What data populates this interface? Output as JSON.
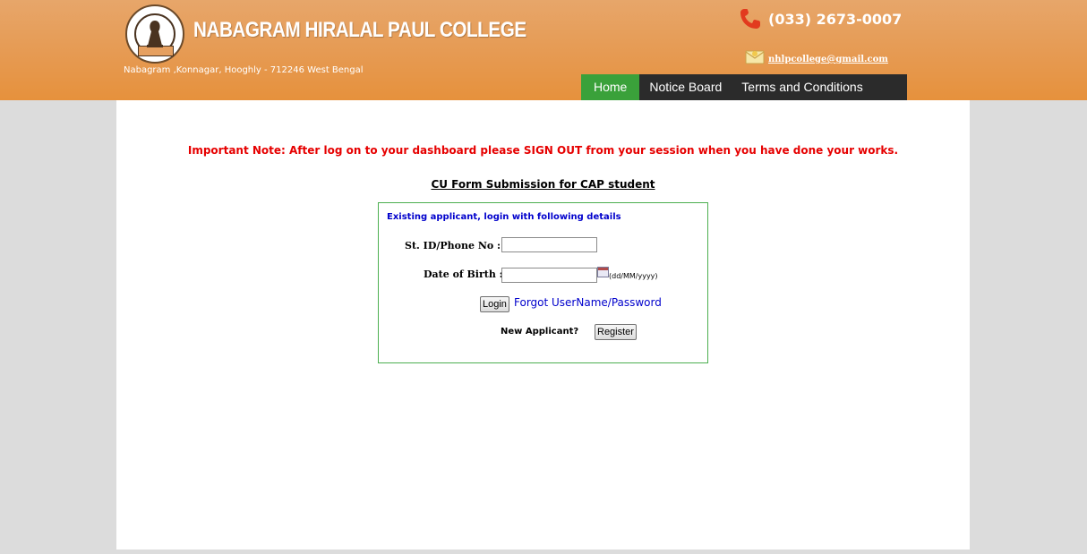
{
  "header": {
    "college_name": "NABAGRAM HIRALAL PAUL COLLEGE",
    "address": "Nabagram ,Konnagar, Hooghly - 712246 West Bengal",
    "phone": "(033) 2673-0007",
    "email": "nhlpcollege@gmail.com",
    "logo_icon": "college-seal-icon",
    "phone_icon": "phone-icon",
    "email_icon": "envelope-icon"
  },
  "nav": {
    "items": [
      {
        "label": "Home",
        "active": true
      },
      {
        "label": "Notice Board",
        "active": false
      },
      {
        "label": "Terms and Conditions",
        "active": false
      }
    ]
  },
  "main": {
    "important_note": "Important Note: After log on to your dashboard please SIGN OUT from your session when you have done your works.",
    "form_title": "CU Form Submission for CAP student",
    "login_box": {
      "heading": "Existing applicant, login with following details",
      "student_id_label": "St. ID/Phone No :",
      "student_id_value": "",
      "dob_label": "Date of Birth :",
      "dob_value": "",
      "dob_hint": "(dd/MM/yyyy)",
      "login_button": "Login",
      "forgot_link": "Forgot UserName/Password",
      "new_applicant_label": "New Applicant?",
      "register_button": "Register"
    }
  },
  "colors": {
    "header_orange": "#e69a52",
    "nav_dark": "#2b2b2b",
    "nav_active_green": "#3aa13a",
    "note_red": "#e60000",
    "link_blue": "#0000cc",
    "box_border_green": "#4caf50"
  }
}
